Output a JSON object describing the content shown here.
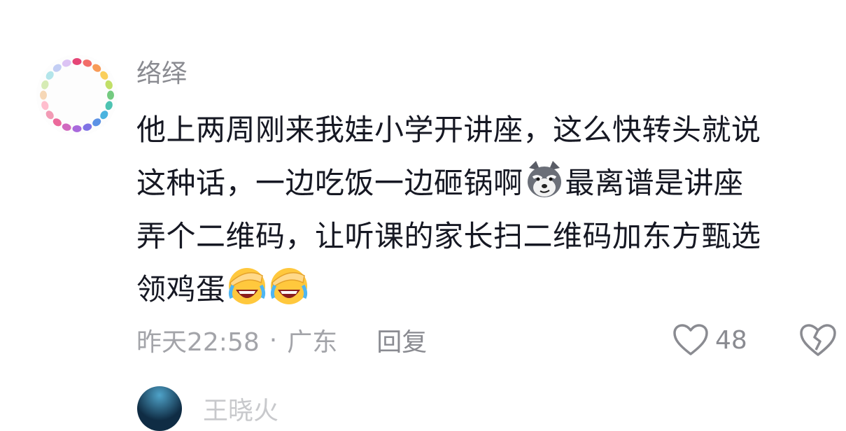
{
  "comment": {
    "username": "络绎",
    "lines": [
      "他上两周刚来我娃小学开讲座，这么快转头就说",
      "这种话，一边吃饭一边砸锅啊",
      "最离谱是讲座",
      "弄个二维码，让听课的家长扫二维码加东方甄选",
      "领鸡蛋"
    ],
    "emojis": [
      "smirk-husky-emoji",
      "facepalm-laugh-emoji",
      "facepalm-laugh-emoji"
    ],
    "timestamp": "昨天22:58",
    "separator": "·",
    "location": "广东",
    "reply_label": "回复",
    "like_count": "48"
  },
  "next_comment": {
    "username_partial": "王晓火"
  }
}
